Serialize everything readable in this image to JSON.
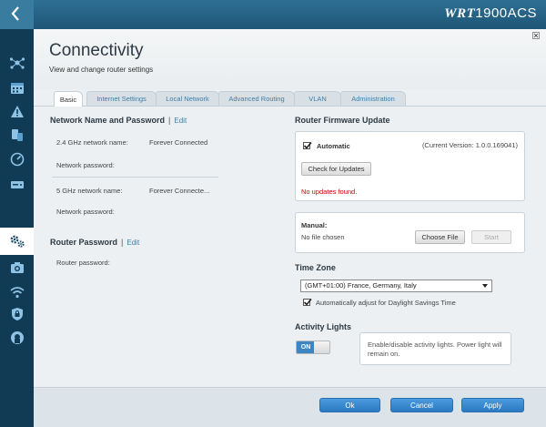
{
  "header": {
    "brand_wrt": "WRT",
    "brand_model": "1900ACS"
  },
  "sidebar": {
    "icons": [
      "network-map-icon",
      "calendar-icon",
      "alert-icon",
      "devices-icon",
      "speed-icon",
      "storage-icon",
      "settings-icon",
      "camera-icon",
      "wifi-icon",
      "security-icon",
      "linksys-icon"
    ]
  },
  "page": {
    "title": "Connectivity",
    "subtitle": "View and change router settings"
  },
  "tabs": [
    {
      "label": "Basic",
      "active": true
    },
    {
      "label": "Internet Settings",
      "active": false
    },
    {
      "label": "Local Network",
      "active": false
    },
    {
      "label": "Advanced Routing",
      "active": false
    },
    {
      "label": "VLAN",
      "active": false
    },
    {
      "label": "Administration",
      "active": false
    }
  ],
  "network": {
    "title": "Network Name and Password",
    "separator": "|",
    "edit": "Edit",
    "band24_label": "2.4 GHz network name:",
    "band24_value": "Forever Connected",
    "password_label_1": "Network password:",
    "band5_label": "5 GHz network name:",
    "band5_value": "Forever Connecte...",
    "password_label_2": "Network password:"
  },
  "router_password": {
    "title": "Router Password",
    "separator": "|",
    "edit": "Edit",
    "label": "Router password:"
  },
  "firmware": {
    "title": "Router Firmware Update",
    "automatic_label": "Automatic",
    "automatic_checked": true,
    "current_version": "(Current Version: 1.0.0.169041)",
    "check_button": "Check for Updates",
    "status": "No updates found.",
    "status_color": "#cc0000",
    "manual_label": "Manual:",
    "file_status": "No file chosen",
    "choose_button": "Choose File",
    "start_button": "Start"
  },
  "timezone": {
    "title": "Time Zone",
    "selected": "(GMT+01:00) France, Germany, Italy",
    "dst_label": "Automatically adjust for Daylight Savings Time",
    "dst_checked": true
  },
  "activity_lights": {
    "title": "Activity Lights",
    "toggle_state": "ON",
    "description": "Enable/disable activity lights. Power light will remain on."
  },
  "footer": {
    "ok": "Ok",
    "cancel": "Cancel",
    "apply": "Apply"
  },
  "colors": {
    "accent": "#3e7ea8",
    "button_blue": "#2a79c1",
    "sidebar": "#113a55"
  }
}
